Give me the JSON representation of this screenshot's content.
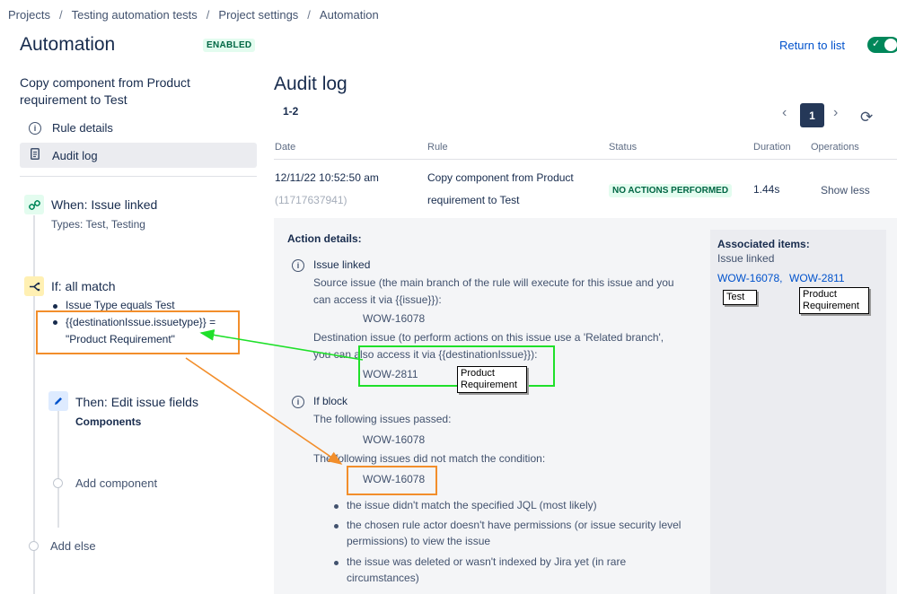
{
  "breadcrumb": [
    "Projects",
    "Testing automation tests",
    "Project settings",
    "Automation"
  ],
  "header": {
    "title": "Automation",
    "status_badge": "ENABLED",
    "return_link": "Return to list"
  },
  "sidebar": {
    "rule_name": "Copy component from Product requirement to Test",
    "menu": [
      {
        "label": "Rule details",
        "icon": "info-icon"
      },
      {
        "label": "Audit log",
        "icon": "document-icon"
      }
    ],
    "components": {
      "trigger": {
        "title": "When: Issue linked",
        "detail": "Types: Test, Testing"
      },
      "condition": {
        "title": "If: all match",
        "items": [
          "Issue Type equals Test",
          "{{destinationIssue.issuetype}} =",
          "\"Product Requirement\""
        ]
      },
      "action": {
        "title": "Then: Edit issue fields",
        "detail": "Components"
      },
      "add_component": "Add component",
      "add_else": "Add else"
    }
  },
  "audit": {
    "title": "Audit log",
    "range": "1-2",
    "current_page": "1",
    "columns": [
      "Date",
      "Rule",
      "Status",
      "Duration",
      "Operations"
    ],
    "row": {
      "date": "12/11/22 10:52:50 am",
      "id": "(11717637941)",
      "rule_line1": "Copy component from Product",
      "rule_line2": "requirement to Test",
      "status": "NO ACTIONS PERFORMED",
      "duration": "1.44s",
      "operation": "Show less"
    },
    "details": {
      "heading": "Action details:",
      "issue_linked": {
        "title": "Issue linked",
        "source_1": "Source issue (the main branch of the rule will execute for this issue and you",
        "source_2": "can access it via {{issue}}):",
        "source_key": "WOW-16078",
        "dest_1": "Destination issue (to perform actions on this issue use a 'Related branch',",
        "dest_2": "you can also access it via {{destinationIssue}}):",
        "dest_key": "WOW-2811"
      },
      "if_block": {
        "title": "If block",
        "passed_label": "The following issues passed:",
        "passed_key": "WOW-16078",
        "failed_label": "The following issues did not match the condition:",
        "failed_key": "WOW-16078",
        "reasons": [
          "the issue didn't match the specified JQL (most likely)",
          "the chosen rule actor doesn't have permissions (or issue security level",
          "permissions) to view the issue",
          "the issue was deleted or wasn't indexed by Jira yet (in rare",
          "circumstances)"
        ]
      }
    },
    "associated": {
      "heading": "Associated items:",
      "sub": "Issue linked",
      "items": [
        "WOW-16078,",
        "WOW-2811"
      ]
    }
  },
  "annotations": {
    "note_test": "Test",
    "note_product_req": "Product Requirement",
    "note_product_req_green": "Product Requirement"
  },
  "colors": {
    "orange": "#f28e2b",
    "green": "#1fe02a",
    "accent": "#0052cc",
    "success": "#00875a"
  }
}
